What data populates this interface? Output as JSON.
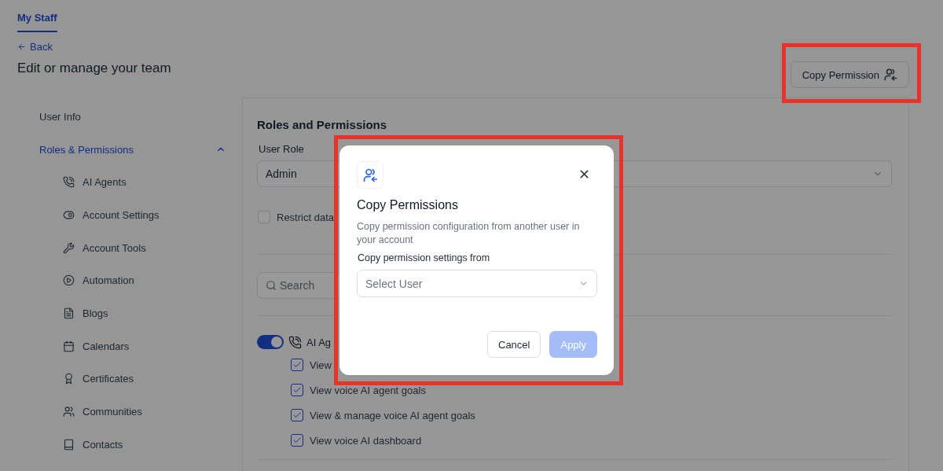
{
  "tabs": [
    {
      "label": "My Staff",
      "selected": true
    }
  ],
  "back_link": "Back",
  "page_title": "Edit or manage your team",
  "copy_button": "Copy Permission",
  "sidebar": {
    "items": [
      {
        "label": "User Info",
        "selected": false
      },
      {
        "label": "Roles & Permissions",
        "selected": true,
        "expanded": true,
        "children": [
          {
            "label": "AI Agents"
          },
          {
            "label": "Account Settings"
          },
          {
            "label": "Account Tools"
          },
          {
            "label": "Automation"
          },
          {
            "label": "Blogs"
          },
          {
            "label": "Calendars"
          },
          {
            "label": "Certificates"
          },
          {
            "label": "Communities"
          },
          {
            "label": "Contacts"
          }
        ]
      }
    ]
  },
  "panel": {
    "title": "Roles and Permissions",
    "user_role": {
      "label": "User Role",
      "value": "Admin"
    },
    "restrict": {
      "label": "Restrict data",
      "checked": false
    },
    "search": {
      "placeholder": "Search"
    },
    "sections": [
      {
        "label": "AI Ag",
        "on": true,
        "permissions": [
          {
            "label": "View",
            "checked": true
          },
          {
            "label": "View voice AI agent goals",
            "checked": true
          },
          {
            "label": "View & manage voice AI agent goals",
            "checked": true
          },
          {
            "label": "View voice AI dashboard",
            "checked": true
          }
        ]
      }
    ]
  },
  "modal": {
    "title": "Copy Permissions",
    "description": "Copy permission configuration from another user in your account",
    "field_label": "Copy permission settings from",
    "select_placeholder": "Select User",
    "buttons": [
      {
        "label": "Cancel",
        "kind": "secondary"
      },
      {
        "label": "Apply",
        "kind": "primary",
        "disabled": true
      }
    ]
  }
}
